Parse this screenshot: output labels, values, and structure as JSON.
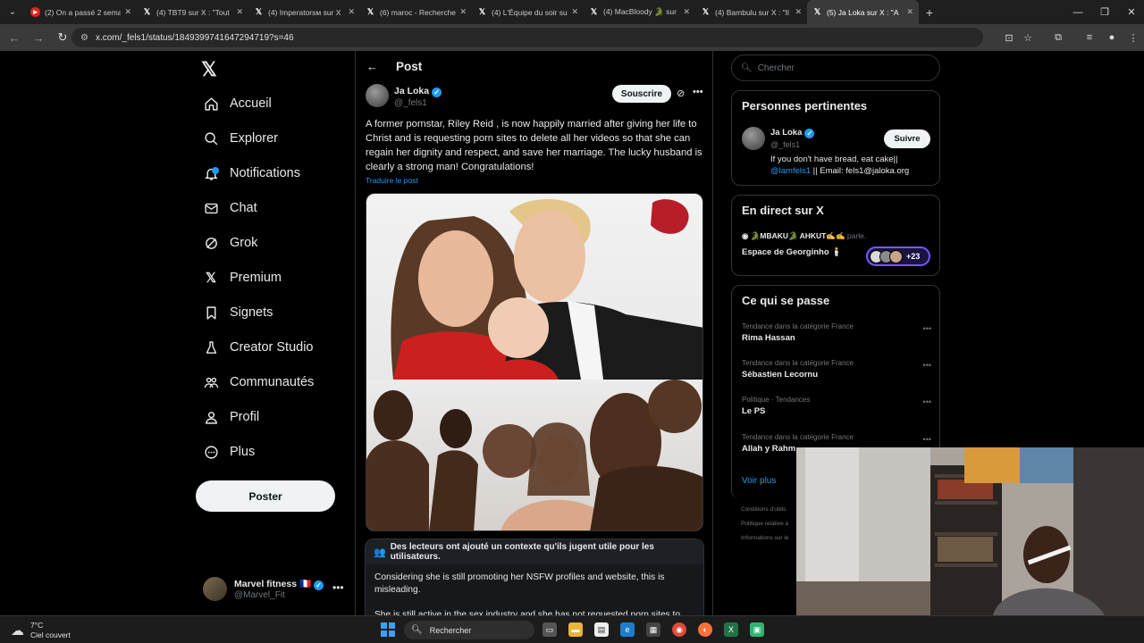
{
  "browser": {
    "tabs": [
      {
        "title": "(2) On a passé 2 semaines",
        "favicon": "youtube-icon"
      },
      {
        "title": "(4) TBT9 sur X : \"Tout",
        "favicon": "x-icon"
      },
      {
        "title": "(4) Imperatorsм sur X",
        "favicon": "x-icon"
      },
      {
        "title": "(6) maroc - Recherche",
        "favicon": "x-icon"
      },
      {
        "title": "(4) L'Équipe du soir sur",
        "favicon": "x-icon"
      },
      {
        "title": "(4) MacBloody 🐊 sur",
        "favicon": "x-icon"
      },
      {
        "title": "(4) Bambulu sur X : \"Il",
        "favicon": "x-icon"
      },
      {
        "title": "(5) Ja Loka sur X : \"A",
        "favicon": "x-icon",
        "active": true
      }
    ],
    "url": "x.com/_fels1/status/1849399741647294719?s=46"
  },
  "nav": {
    "items": [
      {
        "label": "Accueil",
        "icon": "home-icon"
      },
      {
        "label": "Explorer",
        "icon": "search-icon"
      },
      {
        "label": "Notifications",
        "icon": "bell-icon"
      },
      {
        "label": "Chat",
        "icon": "mail-icon"
      },
      {
        "label": "Grok",
        "icon": "grok-icon"
      },
      {
        "label": "Premium",
        "icon": "x-icon"
      },
      {
        "label": "Signets",
        "icon": "bookmark-icon"
      },
      {
        "label": "Creator Studio",
        "icon": "flask-icon"
      },
      {
        "label": "Communautés",
        "icon": "people-icon"
      },
      {
        "label": "Profil",
        "icon": "user-icon"
      },
      {
        "label": "Plus",
        "icon": "more-circle-icon"
      }
    ],
    "post_button": "Poster",
    "account": {
      "name": "Marvel fitness 🇫🇷",
      "handle": "@Marvel_Fit"
    }
  },
  "post": {
    "header": "Post",
    "author_name": "Ja Loka",
    "author_handle": "@_fels1",
    "subscribe_label": "Souscrire",
    "text": "A former pornstar, Riley Reid , is now happily married after giving her life to Christ and is requesting porn sites to delete all her videos so that she can regain her dignity and respect, and save her marriage. The lucky husband is clearly a strong man! Congratulations!",
    "translate_label": "Traduire le post",
    "note": {
      "title": "Des lecteurs ont ajouté un contexte qu'ils jugent utile pour les utilisateurs.",
      "body1": "Considering she is still promoting her NSFW profiles and website, this is misleading.",
      "body2": "She is still active in the sex industry and she has not  requested porn sites to"
    }
  },
  "sidebar": {
    "search_placeholder": "Chercher",
    "relevant": {
      "title": "Personnes pertinentes",
      "name": "Ja Loka",
      "handle": "@_fels1",
      "follow_label": "Suivre",
      "bio_line1": "If you don't have bread, eat cake||",
      "bio_link": "@lamfels1",
      "bio_line2_rest": " || Email: fels1@jaloka.org"
    },
    "live": {
      "title": "En direct sur X",
      "hosts": "🐊MBAKU🐊 AHKUT✍️✍️",
      "hosts_suffix": "parle.",
      "space_name": "Espace de Georginho 🕯️",
      "listener_count": "+23"
    },
    "trends": {
      "title": "Ce qui se passe",
      "items": [
        {
          "category": "Tendance dans la catégorie France",
          "name": "Rima Hassan"
        },
        {
          "category": "Tendance dans la catégorie France",
          "name": "Sébastien Lecornu"
        },
        {
          "category": "Politique · Tendances",
          "name": "Le PS"
        },
        {
          "category": "Tendance dans la catégorie France",
          "name": "Allah y Rahm"
        }
      ],
      "show_more": "Voir plus"
    },
    "footer": [
      "Conditions d'utilis",
      "Politique relative à",
      "Informations sur le"
    ]
  },
  "taskbar": {
    "weather_temp": "7°C",
    "weather_desc": "Ciel couvert",
    "search_label": "Rechercher"
  },
  "colors": {
    "accent": "#1d9bf0",
    "background": "#000000",
    "border": "#2f3336",
    "muted": "#71767b"
  }
}
